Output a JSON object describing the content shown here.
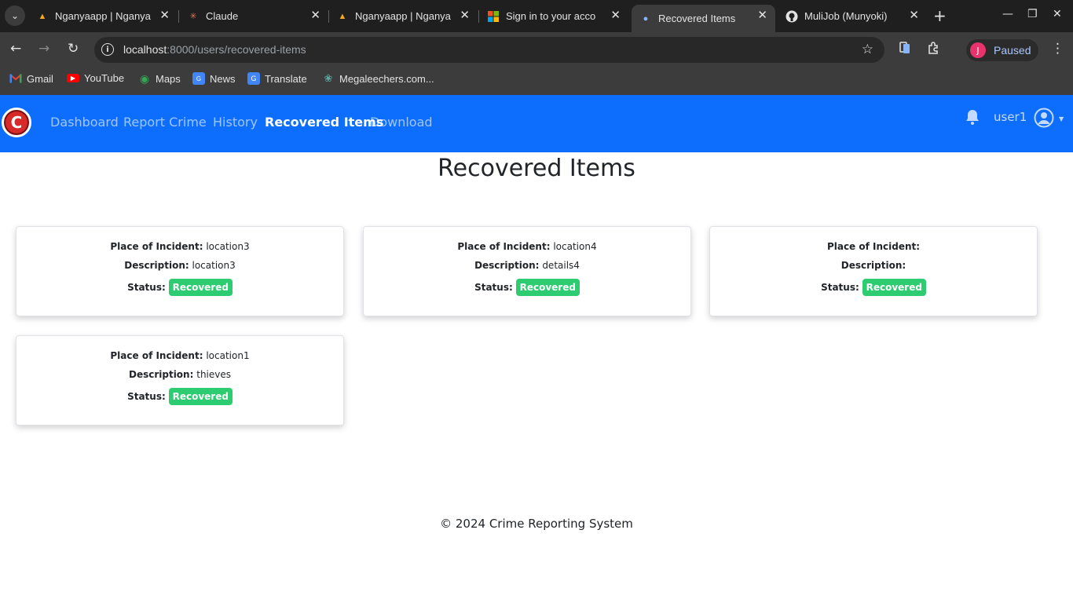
{
  "browser": {
    "tabs": [
      {
        "title": "Nganyaapp | Nganya",
        "favicon": "nganya-icon"
      },
      {
        "title": "Claude",
        "favicon": "claude-icon"
      },
      {
        "title": "Nganyaapp | Nganya",
        "favicon": "nganya-icon"
      },
      {
        "title": "Sign in to your acco",
        "favicon": "microsoft-icon"
      },
      {
        "title": "Recovered Items",
        "favicon": "user-icon",
        "active": true
      },
      {
        "title": "MuliJob (Munyoki)",
        "favicon": "github-icon"
      }
    ],
    "url_host": "localhost",
    "url_rest": ":8000/users/recovered-items",
    "profile_initial": "J",
    "profile_status": "Paused",
    "bookmarks": [
      {
        "label": "Gmail",
        "icon": "gmail-icon"
      },
      {
        "label": "YouTube",
        "icon": "youtube-icon"
      },
      {
        "label": "Maps",
        "icon": "maps-icon"
      },
      {
        "label": "News",
        "icon": "news-icon"
      },
      {
        "label": "Translate",
        "icon": "translate-icon"
      },
      {
        "label": "Megaleechers.com...",
        "icon": "megaleechers-icon"
      }
    ]
  },
  "app": {
    "logo_letter": "C",
    "nav": [
      {
        "label": "Dashboard"
      },
      {
        "label": "Report Crime"
      },
      {
        "label": "History"
      },
      {
        "label": "Recovered Items",
        "active": true
      },
      {
        "label": "Download"
      }
    ],
    "username": "user1"
  },
  "page": {
    "title": "Recovered Items",
    "labels": {
      "place": "Place of Incident:",
      "description": "Description:",
      "status": "Status:"
    },
    "items": [
      {
        "place": "location3",
        "description": "location3",
        "status": "Recovered"
      },
      {
        "place": "location4",
        "description": "details4",
        "status": "Recovered"
      },
      {
        "place": "",
        "description": "",
        "status": "Recovered"
      },
      {
        "place": "location1",
        "description": "thieves",
        "status": "Recovered"
      }
    ],
    "footer": "© 2024 Crime Reporting System"
  },
  "colors": {
    "navbar": "#0d6efd",
    "badge": "#2ecc71",
    "logo": "#d92a2a"
  }
}
